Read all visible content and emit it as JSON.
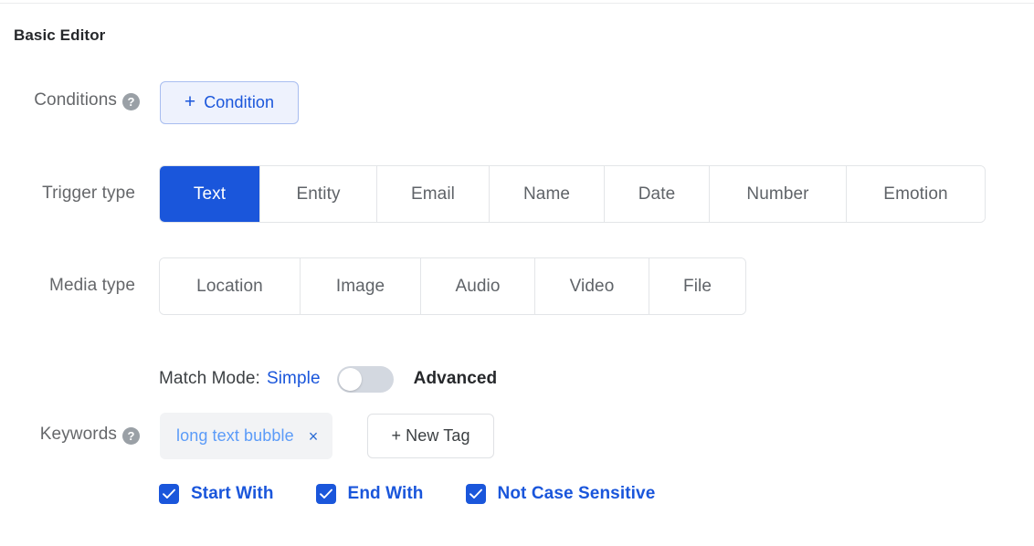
{
  "section": {
    "title": "Basic Editor"
  },
  "conditions": {
    "label": "Conditions",
    "help_icon": "help-circle-icon",
    "help_glyph": "?",
    "add_button": {
      "plus": "+",
      "label": "Condition"
    }
  },
  "trigger_type": {
    "label": "Trigger type",
    "selected": "Text",
    "options": [
      {
        "label": "Text",
        "active": true,
        "width": 110
      },
      {
        "label": "Entity",
        "active": false,
        "width": 128
      },
      {
        "label": "Email",
        "active": false,
        "width": 123
      },
      {
        "label": "Name",
        "active": false,
        "width": 126
      },
      {
        "label": "Date",
        "active": false,
        "width": 115
      },
      {
        "label": "Number",
        "active": false,
        "width": 150
      },
      {
        "label": "Emotion",
        "active": false,
        "width": 151
      }
    ]
  },
  "media_type": {
    "label": "Media type",
    "selected": null,
    "options": [
      {
        "label": "Location",
        "active": false,
        "width": 154
      },
      {
        "label": "Image",
        "active": false,
        "width": 132
      },
      {
        "label": "Audio",
        "active": false,
        "width": 125
      },
      {
        "label": "Video",
        "active": false,
        "width": 125
      },
      {
        "label": "File",
        "active": false,
        "width": 105
      }
    ]
  },
  "match_mode": {
    "label": "Match Mode:",
    "simple_label": "Simple",
    "advanced_label": "Advanced",
    "toggle_on": false,
    "active_mode": "Simple"
  },
  "keywords": {
    "label": "Keywords",
    "help_icon": "help-circle-icon",
    "help_glyph": "?",
    "tags": [
      {
        "text": "long text bubble",
        "close_glyph": "×"
      }
    ],
    "new_tag_button": "+ New Tag"
  },
  "options": [
    {
      "label": "Start With",
      "checked": true
    },
    {
      "label": "End With",
      "checked": true
    },
    {
      "label": "Not Case Sensitive",
      "checked": true
    }
  ],
  "colors": {
    "accent_blue": "#1a56db",
    "tag_text_blue": "#5b9bf8",
    "condition_bg": "#eef2fd",
    "condition_border": "#a8bdf0",
    "toggle_track": "#d3d8e0",
    "border_gray": "#e3e5e8",
    "label_gray": "#65676a",
    "tag_bg": "#f2f3f5"
  }
}
